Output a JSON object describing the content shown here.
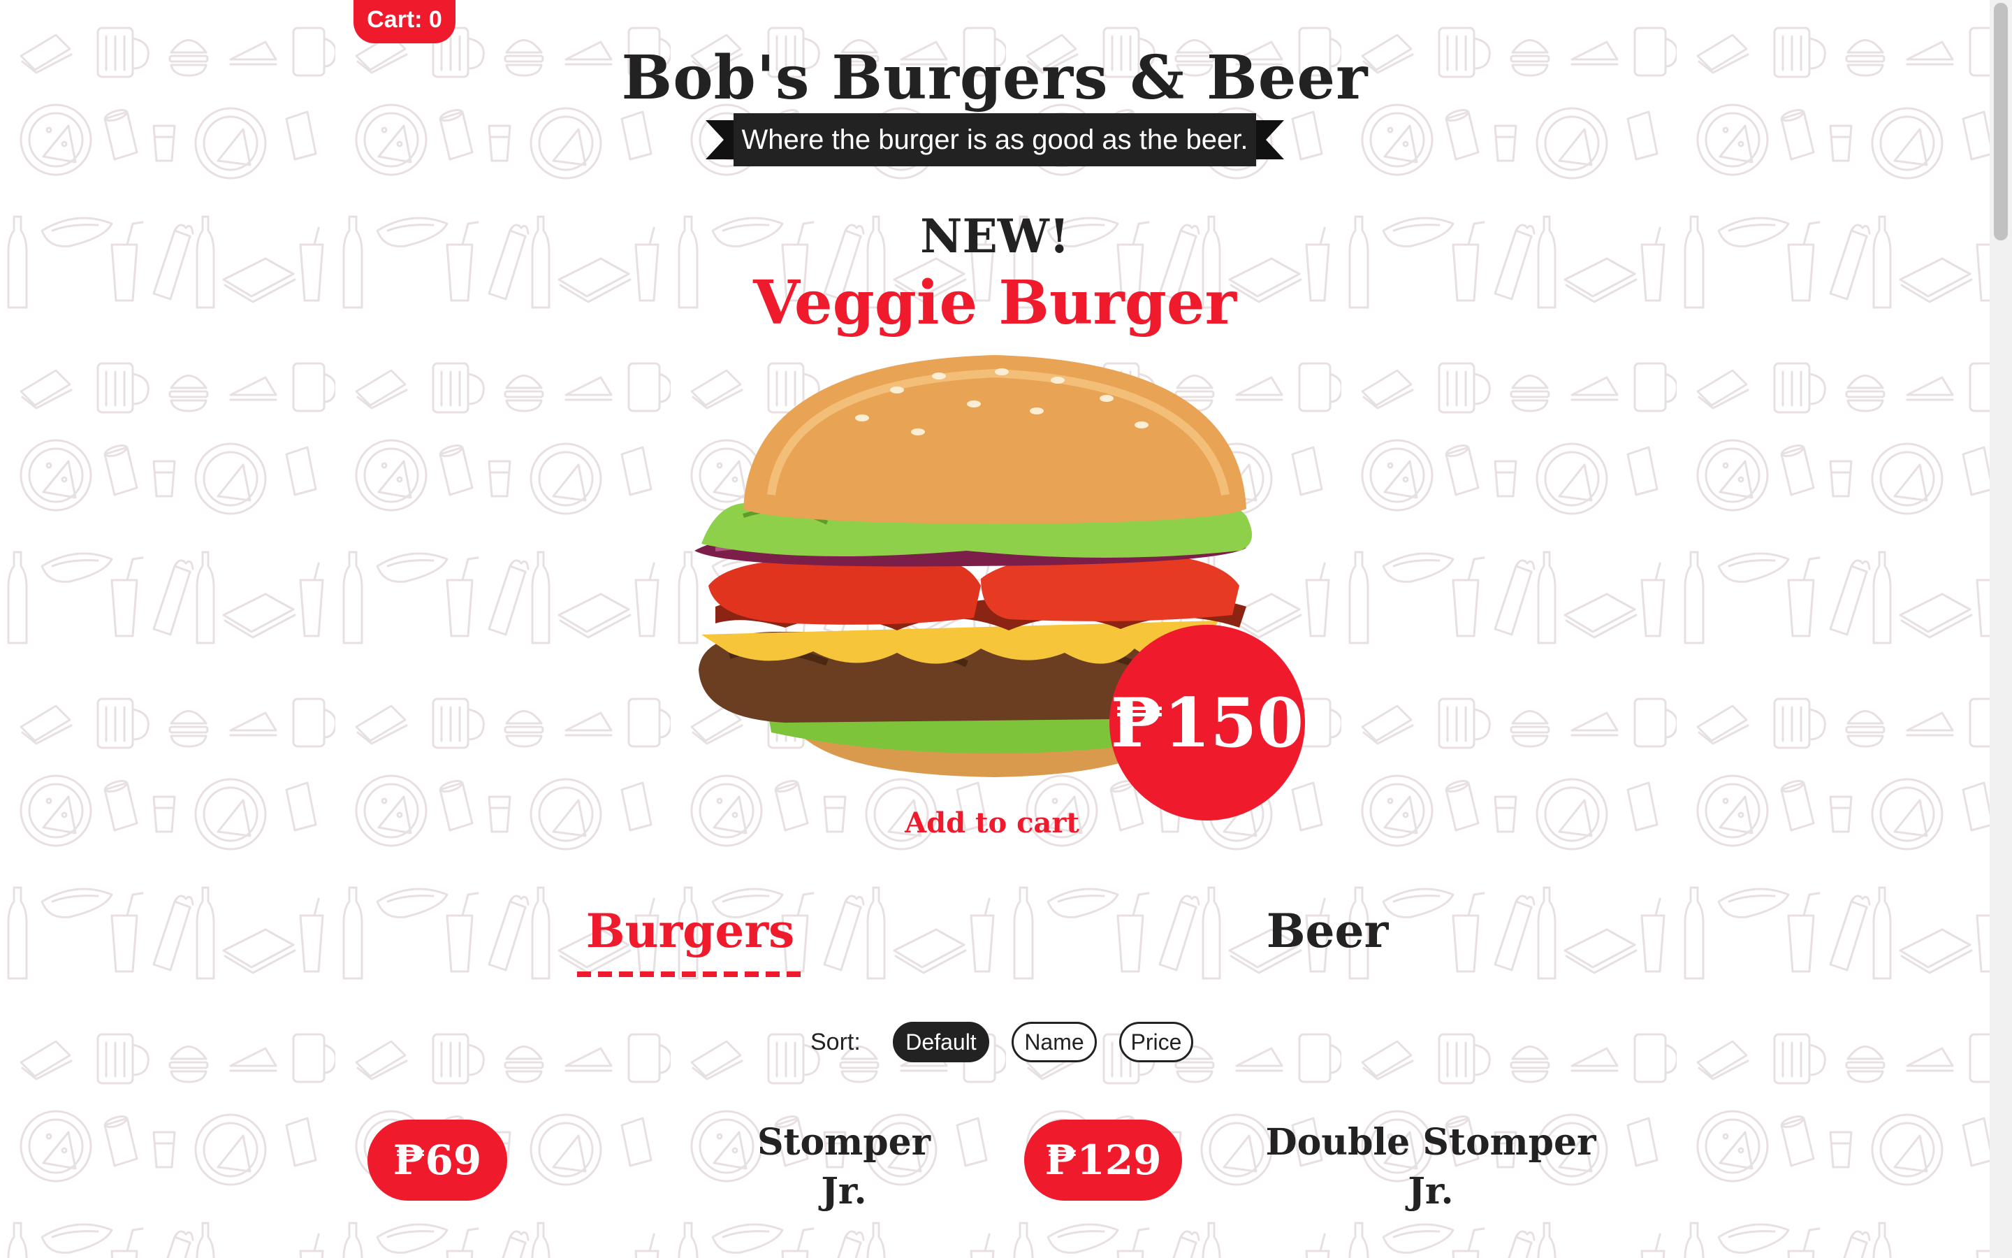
{
  "cart": {
    "label": "Cart: 0"
  },
  "header": {
    "title": "Bob's Burgers & Beer",
    "tagline": "Where the burger is as good as the beer."
  },
  "featured": {
    "badge": "NEW!",
    "name": "Veggie Burger",
    "price": "₱150",
    "add_to_cart": "Add to cart"
  },
  "tabs": [
    {
      "label": "Burgers",
      "active": true
    },
    {
      "label": "Beer",
      "active": false
    }
  ],
  "sort": {
    "label": "Sort:",
    "options": [
      {
        "label": "Default",
        "active": true
      },
      {
        "label": "Name",
        "active": false
      },
      {
        "label": "Price",
        "active": false
      }
    ]
  },
  "items": [
    {
      "price": "₱69",
      "name": "Stomper Jr."
    },
    {
      "price": "₱129",
      "name": "Double Stomper Jr."
    }
  ],
  "colors": {
    "accent": "#ef1b2d",
    "dark": "#222222",
    "pattern": "#ece4e6"
  }
}
